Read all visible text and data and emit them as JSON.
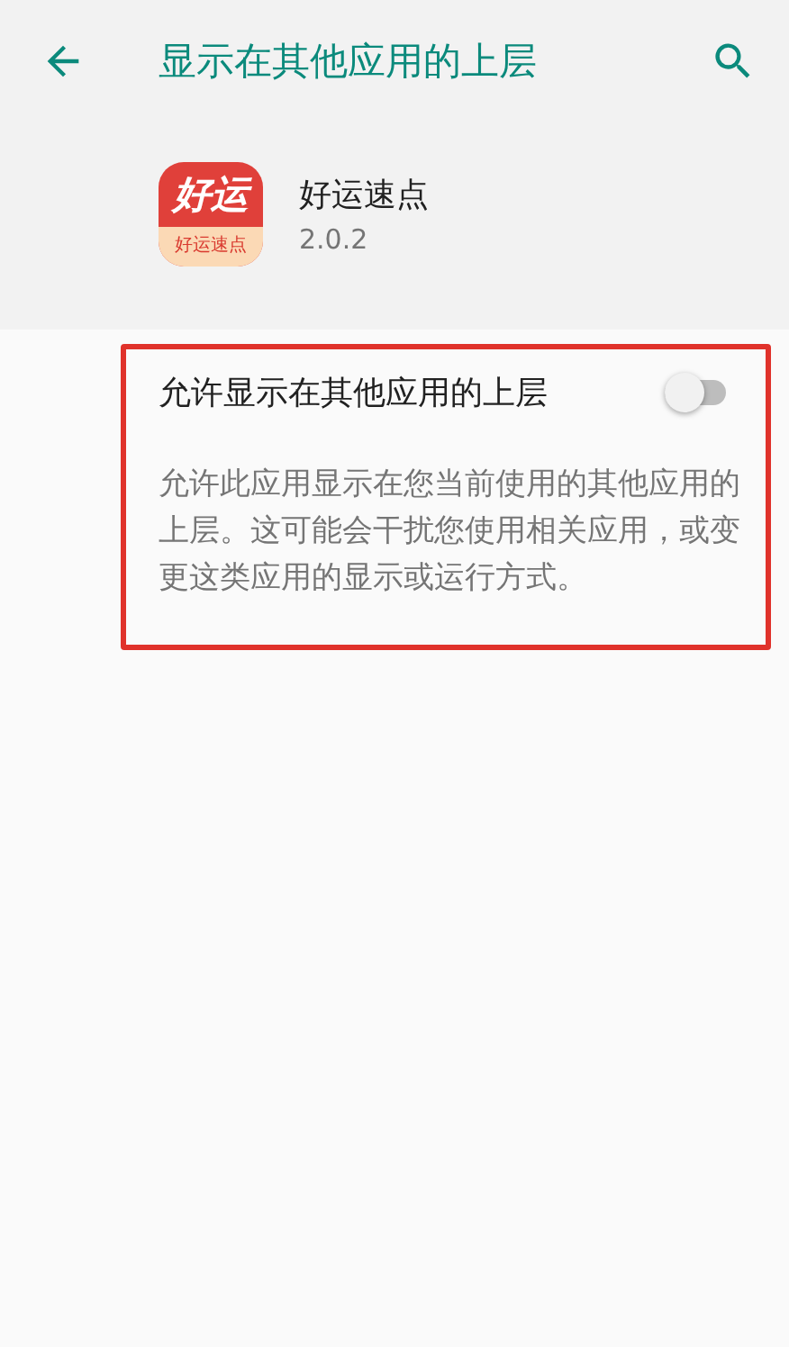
{
  "app_bar": {
    "title": "显示在其他应用的上层"
  },
  "app": {
    "name": "好运速点",
    "version": "2.0.2",
    "icon": {
      "title": "好运",
      "subtitle": "好运速点"
    }
  },
  "permission": {
    "label": "允许显示在其他应用的上层",
    "on": false,
    "highlighted": true,
    "description": "允许此应用显示在您当前使用的其他应用的上层。这可能会干扰您使用相关应用，或变更这类应用的显示或运行方式。"
  }
}
